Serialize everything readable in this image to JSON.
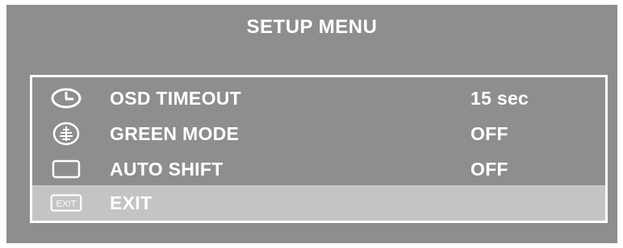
{
  "title": "SETUP MENU",
  "menu": {
    "items": [
      {
        "label": "OSD TIMEOUT",
        "value": "15 sec",
        "icon": "clock-icon"
      },
      {
        "label": "GREEN MODE",
        "value": "OFF",
        "icon": "tree-icon"
      },
      {
        "label": "AUTO SHIFT",
        "value": "OFF",
        "icon": "screen-icon"
      },
      {
        "label": "EXIT",
        "value": "",
        "icon": "exit-icon",
        "icon_text": "EXIT",
        "selected": true
      }
    ]
  },
  "colors": {
    "background": "#8e8e8e",
    "highlight": "#c4c4c4",
    "text": "#ffffff"
  }
}
